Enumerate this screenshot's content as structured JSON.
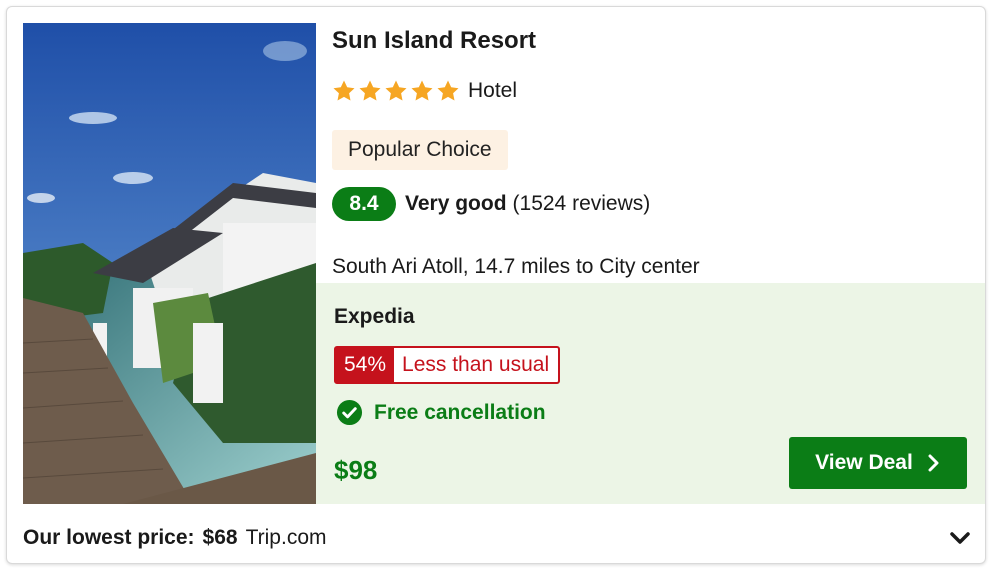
{
  "hotel": {
    "name": "Sun Island Resort",
    "star_rating": 5,
    "type": "Hotel",
    "badge": "Popular Choice",
    "score": "8.4",
    "rating_label": "Very good",
    "reviews": "(1524 reviews)",
    "location": "South Ari Atoll, 14.7 miles to City center"
  },
  "deal": {
    "provider": "Expedia",
    "discount_percent": "54%",
    "discount_label": "Less than usual",
    "cancellation": "Free cancellation",
    "price": "$98",
    "cta_label": "View Deal"
  },
  "footer": {
    "lowest_label": "Our lowest price:",
    "lowest_price": "$68",
    "lowest_provider": "Trip.com"
  },
  "colors": {
    "brand_green": "#0b7d16",
    "discount_red": "#c5121c",
    "star_orange": "#f6a623",
    "deal_bg": "#ecf5e6",
    "badge_bg": "#fdf1e3"
  },
  "icons": {
    "star": "star-icon",
    "check": "check-circle-icon",
    "cta": "chevron-right-icon",
    "expand": "chevron-down-icon"
  }
}
